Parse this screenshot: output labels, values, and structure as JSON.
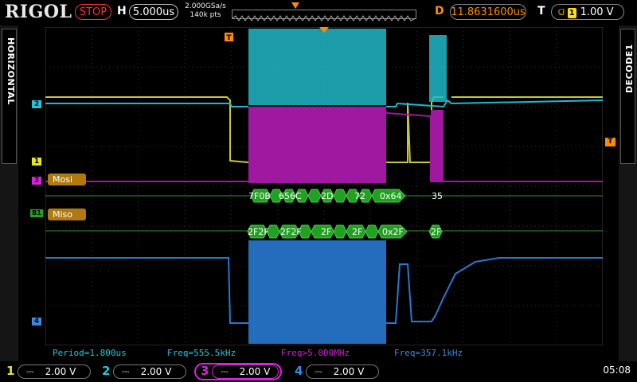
{
  "top": {
    "logo": "RIGOL",
    "run_state": "STOP",
    "h_label": "H",
    "timebase": "5.000us",
    "sample_rate": "2.000GSa/s",
    "mem_depth": "140k pts",
    "d_label": "D",
    "delay": "11.8631600us",
    "t_label": "T",
    "trigger_edge": "⫑",
    "trigger_source": "1",
    "trigger_level": "1.00 V"
  },
  "side": {
    "left_tab": "HORIZONTAL",
    "right_tab": "DECODE1"
  },
  "markers": {
    "ch2": "2",
    "ch1": "1",
    "ch3": "3",
    "b1": "B1",
    "ch4": "4",
    "trig": "T",
    "mosi": "Mosi",
    "miso": "Miso"
  },
  "decode": {
    "mosi": [
      "7F0B",
      "656C",
      "2D",
      "72",
      "0x64",
      "35"
    ],
    "miso": [
      "2F2F",
      "2F2F",
      "2F",
      "2F",
      "0x2F",
      "2F"
    ]
  },
  "measurements": [
    {
      "text": "Period=1.800us",
      "color": "#22c8d8"
    },
    {
      "text": "Freq=555.5kHz",
      "color": "#22c8d8"
    },
    {
      "text": "Freq>5.000MHz",
      "color": "#d020d0"
    },
    {
      "text": "Freq=357.1kHz",
      "color": "#3a8ce0"
    }
  ],
  "channels": [
    {
      "num": "1",
      "scale": "2.00 V",
      "color": "#e6e619"
    },
    {
      "num": "2",
      "scale": "2.00 V",
      "color": "#22c8d8"
    },
    {
      "num": "3",
      "scale": "2.00 V",
      "color": "#e020e0"
    },
    {
      "num": "4",
      "scale": "2.00 V",
      "color": "#3a8ce0"
    }
  ],
  "coupling_symbol": "⎓",
  "clock": "05:08",
  "colors": {
    "ch1": "#c8c832",
    "ch2": "#22b8c8",
    "ch3": "#a018a0",
    "ch4": "#2878d0",
    "decode_bus": "#22a022",
    "accent": "#ff8c00"
  }
}
